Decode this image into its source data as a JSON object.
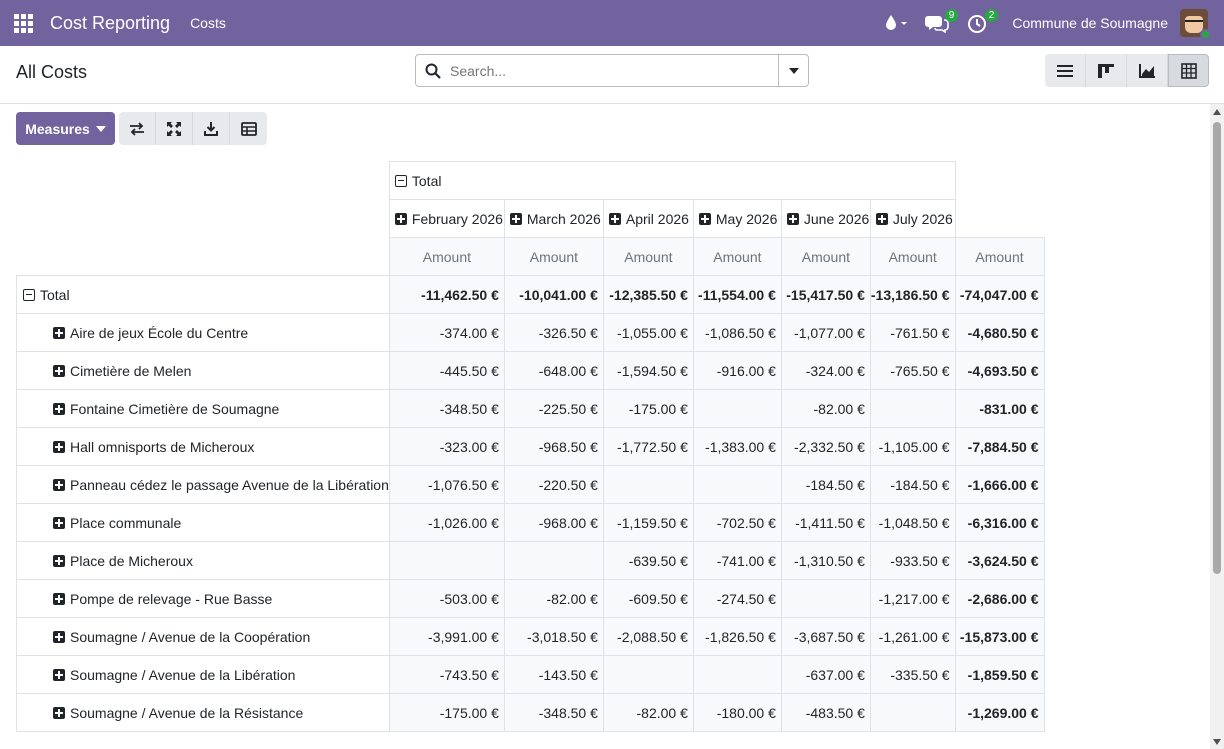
{
  "navbar": {
    "app_name": "Cost Reporting",
    "menu": "Costs",
    "messages_count": "9",
    "activities_count": "2",
    "company": "Commune de Soumagne",
    "colors": {
      "primary": "#71639e",
      "badge": "#28a745"
    }
  },
  "control": {
    "breadcrumb": "All Costs",
    "search_placeholder": "Search..."
  },
  "toolbar": {
    "measures_label": "Measures"
  },
  "pivot": {
    "col_total_label": "Total",
    "months": [
      "February 2026",
      "March 2026",
      "April 2026",
      "May 2026",
      "June 2026",
      "July 2026"
    ],
    "measure_label": "Amount",
    "row_total_label": "Total",
    "total_row": [
      "-11,462.50 €",
      "-10,041.00 €",
      "-12,385.50 €",
      "-11,554.00 €",
      "-15,417.50 €",
      "-13,186.50 €",
      "-74,047.00 €"
    ],
    "rows": [
      {
        "label": "Aire de jeux École du Centre",
        "values": [
          "-374.00 €",
          "-326.50 €",
          "-1,055.00 €",
          "-1,086.50 €",
          "-1,077.00 €",
          "-761.50 €",
          "-4,680.50 €"
        ]
      },
      {
        "label": "Cimetière de Melen",
        "values": [
          "-445.50 €",
          "-648.00 €",
          "-1,594.50 €",
          "-916.00 €",
          "-324.00 €",
          "-765.50 €",
          "-4,693.50 €"
        ]
      },
      {
        "label": "Fontaine Cimetière de Soumagne",
        "values": [
          "-348.50 €",
          "-225.50 €",
          "-175.00 €",
          "",
          "-82.00 €",
          "",
          "-831.00 €"
        ]
      },
      {
        "label": "Hall omnisports de Micheroux",
        "values": [
          "-323.00 €",
          "-968.50 €",
          "-1,772.50 €",
          "-1,383.00 €",
          "-2,332.50 €",
          "-1,105.00 €",
          "-7,884.50 €"
        ]
      },
      {
        "label": "Panneau cédez le passage Avenue de la Libération",
        "values": [
          "-1,076.50 €",
          "-220.50 €",
          "",
          "",
          "-184.50 €",
          "-184.50 €",
          "-1,666.00 €"
        ]
      },
      {
        "label": "Place communale",
        "values": [
          "-1,026.00 €",
          "-968.00 €",
          "-1,159.50 €",
          "-702.50 €",
          "-1,411.50 €",
          "-1,048.50 €",
          "-6,316.00 €"
        ]
      },
      {
        "label": "Place de Micheroux",
        "values": [
          "",
          "",
          "-639.50 €",
          "-741.00 €",
          "-1,310.50 €",
          "-933.50 €",
          "-3,624.50 €"
        ]
      },
      {
        "label": "Pompe de relevage - Rue Basse",
        "values": [
          "-503.00 €",
          "-82.00 €",
          "-609.50 €",
          "-274.50 €",
          "",
          "-1,217.00 €",
          "-2,686.00 €"
        ]
      },
      {
        "label": "Soumagne / Avenue de la Coopération",
        "values": [
          "-3,991.00 €",
          "-3,018.50 €",
          "-2,088.50 €",
          "-1,826.50 €",
          "-3,687.50 €",
          "-1,261.00 €",
          "-15,873.00 €"
        ]
      },
      {
        "label": "Soumagne / Avenue de la Libération",
        "values": [
          "-743.50 €",
          "-143.50 €",
          "",
          "",
          "-637.00 €",
          "-335.50 €",
          "-1,859.50 €"
        ]
      },
      {
        "label": "Soumagne / Avenue de la Résistance",
        "values": [
          "-175.00 €",
          "-348.50 €",
          "-82.00 €",
          "-180.00 €",
          "-483.50 €",
          "",
          "-1,269.00 €"
        ]
      }
    ]
  }
}
